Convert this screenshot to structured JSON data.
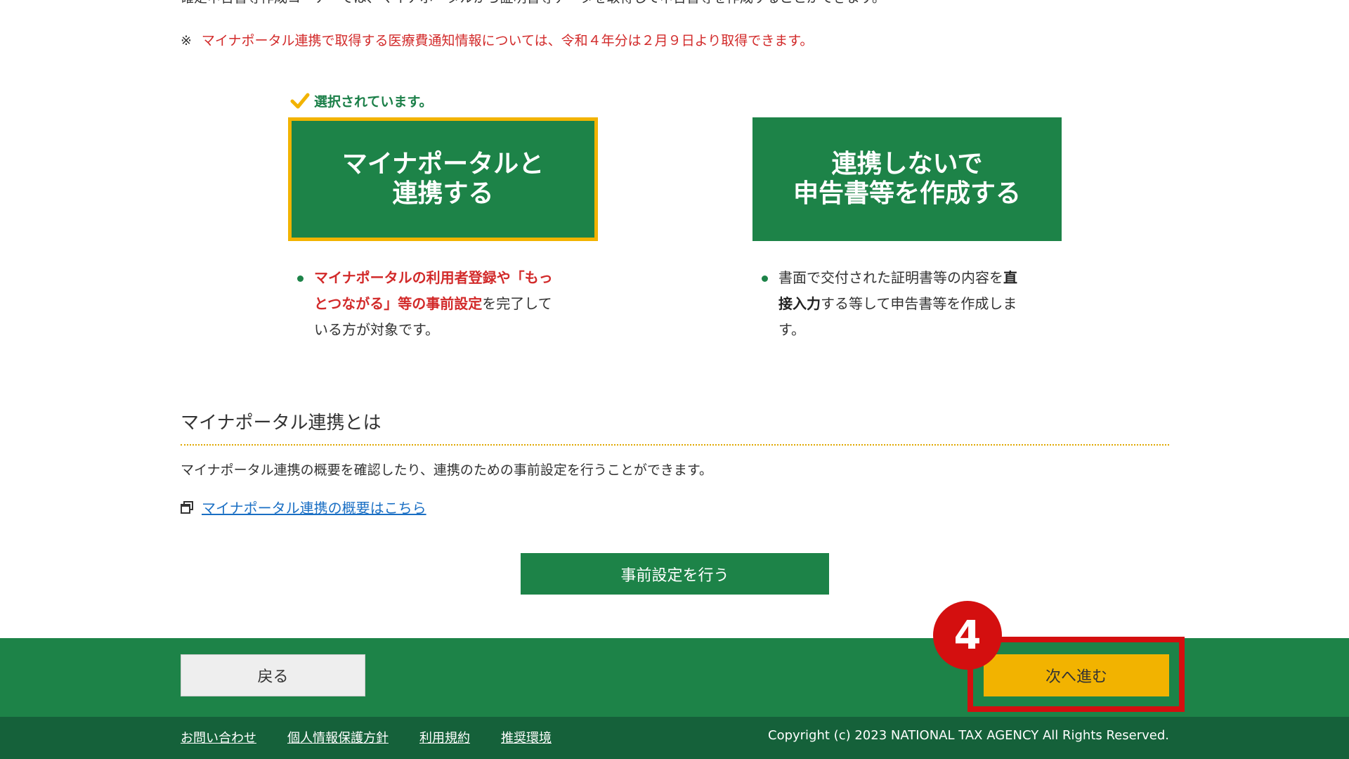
{
  "intro_text": "確定申告書等作成コーナーでは、マイナポータルから証明書等データを取得して申告書等を作成することができます。",
  "notice": {
    "mark": "※",
    "text": "マイナポータル連携で取得する医療費通知情報については、令和４年分は２月９日より取得できます。"
  },
  "selected_label": "選択されています。",
  "choices": [
    {
      "label": "マイナポータルと\n連携する",
      "desc": {
        "line1_red": "マイナポータルの利用者登録や「もっ",
        "line2_red": "とつながる」等の事前設定",
        "line2_rest": "を完了して",
        "line3": "いる方が対象です。"
      }
    },
    {
      "label": "連携しないで\n申告書等を作成する",
      "desc": {
        "line1_plain": "書面で交付された証明書等の内容を",
        "line1_bold": "直",
        "line2_bold": "接入力",
        "line2_rest": "する等して申告書等を作成しま",
        "line3": "す。"
      }
    }
  ],
  "section": {
    "title": "マイナポータル連携とは",
    "text": "マイナポータル連携の概要を確認したり、連携のための事前設定を行うことができます。",
    "link": "マイナポータル連携の概要はこちら",
    "settings_button": "事前設定を行う"
  },
  "nav": {
    "back": "戻る",
    "next": "次へ進む",
    "step_badge": "4"
  },
  "footer": {
    "links": [
      "お問い合わせ",
      "個人情報保護方針",
      "利用規約",
      "推奨環境"
    ],
    "copyright": "Copyright (c) 2023 NATIONAL TAX AGENCY All Rights Reserved."
  },
  "colors": {
    "primary_green": "#1d8348",
    "footer_green": "#15613a",
    "accent_yellow": "#f2b300",
    "alert_red": "#d22a2a",
    "annotation_red": "#d40f0f",
    "link_blue": "#1a6fc4"
  },
  "icons": {
    "selected": "checkmark-icon",
    "link": "new-window-icon"
  }
}
